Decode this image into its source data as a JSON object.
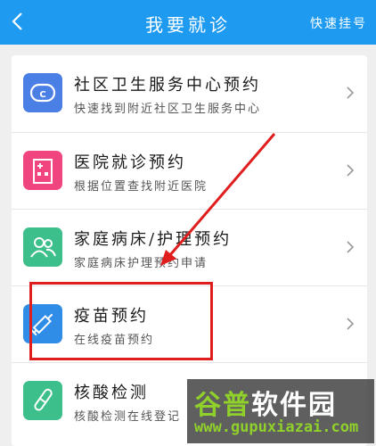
{
  "header": {
    "title": "我要就诊",
    "action": "快速挂号"
  },
  "items": [
    {
      "title": "社区卫生服务中心预约",
      "subtitle": "快速找到附近社区卫生服务中心",
      "icon": "community-center-icon",
      "color": "#4a7fe6"
    },
    {
      "title": "医院就诊预约",
      "subtitle": "根据位置查找附近医院",
      "icon": "hospital-building-icon",
      "color": "#f0457e"
    },
    {
      "title": "家庭病床/护理预约",
      "subtitle": "家庭病床护理预约申请",
      "icon": "people-icon",
      "color": "#3cbf8a"
    },
    {
      "title": "疫苗预约",
      "subtitle": "在线疫苗预约",
      "icon": "syringe-icon",
      "color": "#2f8de8"
    },
    {
      "title": "核酸检测",
      "subtitle": "核酸检测在线登记",
      "icon": "test-tube-icon",
      "color": "#3cbf8a"
    }
  ],
  "watermark": {
    "brand_part1": "谷普",
    "brand_part2": "软件园",
    "url": "www.gupuxiazai.com"
  }
}
